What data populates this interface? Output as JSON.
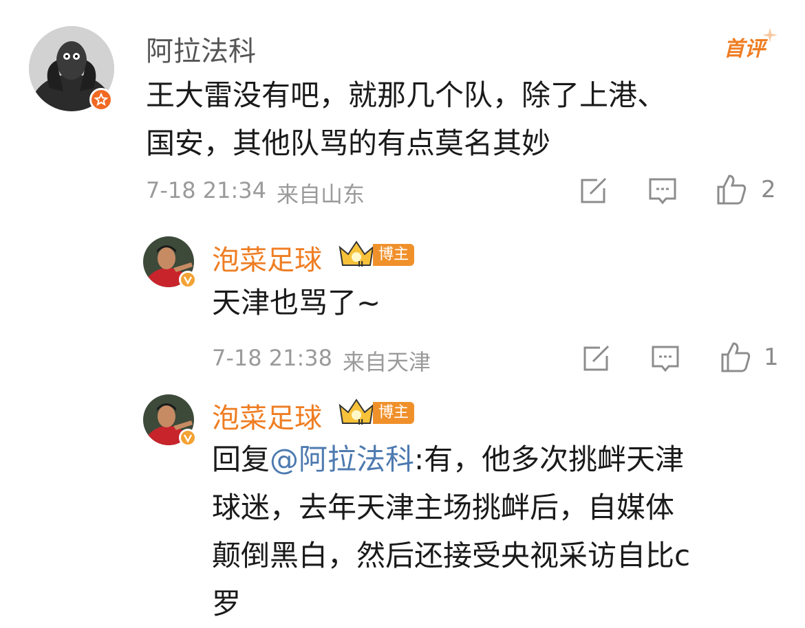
{
  "comment1": {
    "username": "阿拉法科",
    "tag": "首评",
    "text_line1": "王大雷没有吧，就那几个队，除了上港、",
    "text_line2": "国安，其他队骂的有点莫名其妙",
    "time": "7-18 21:34",
    "location": "来自山东",
    "like_count": "2",
    "colors": {
      "tag": "#ef7d22",
      "badge": "#f06a23"
    }
  },
  "reply1": {
    "username": "泡菜足球",
    "role_badge": "博主",
    "level": "II",
    "text": "天津也骂了~",
    "time": "7-18 21:38",
    "location": "来自天津",
    "like_count": "1",
    "verified_icon": "v-badge-icon"
  },
  "reply2": {
    "username": "泡菜足球",
    "role_badge": "博主",
    "level": "II",
    "reply_prefix": "回复",
    "mention": "@阿拉法科",
    "text_line1_rest": ":有，他多次挑衅天津",
    "text_line2": "球迷，去年天津主场挑衅后，自媒体",
    "text_line3": "颠倒黑白，然后还接受央视采访自比c",
    "text_line4": "罗"
  }
}
